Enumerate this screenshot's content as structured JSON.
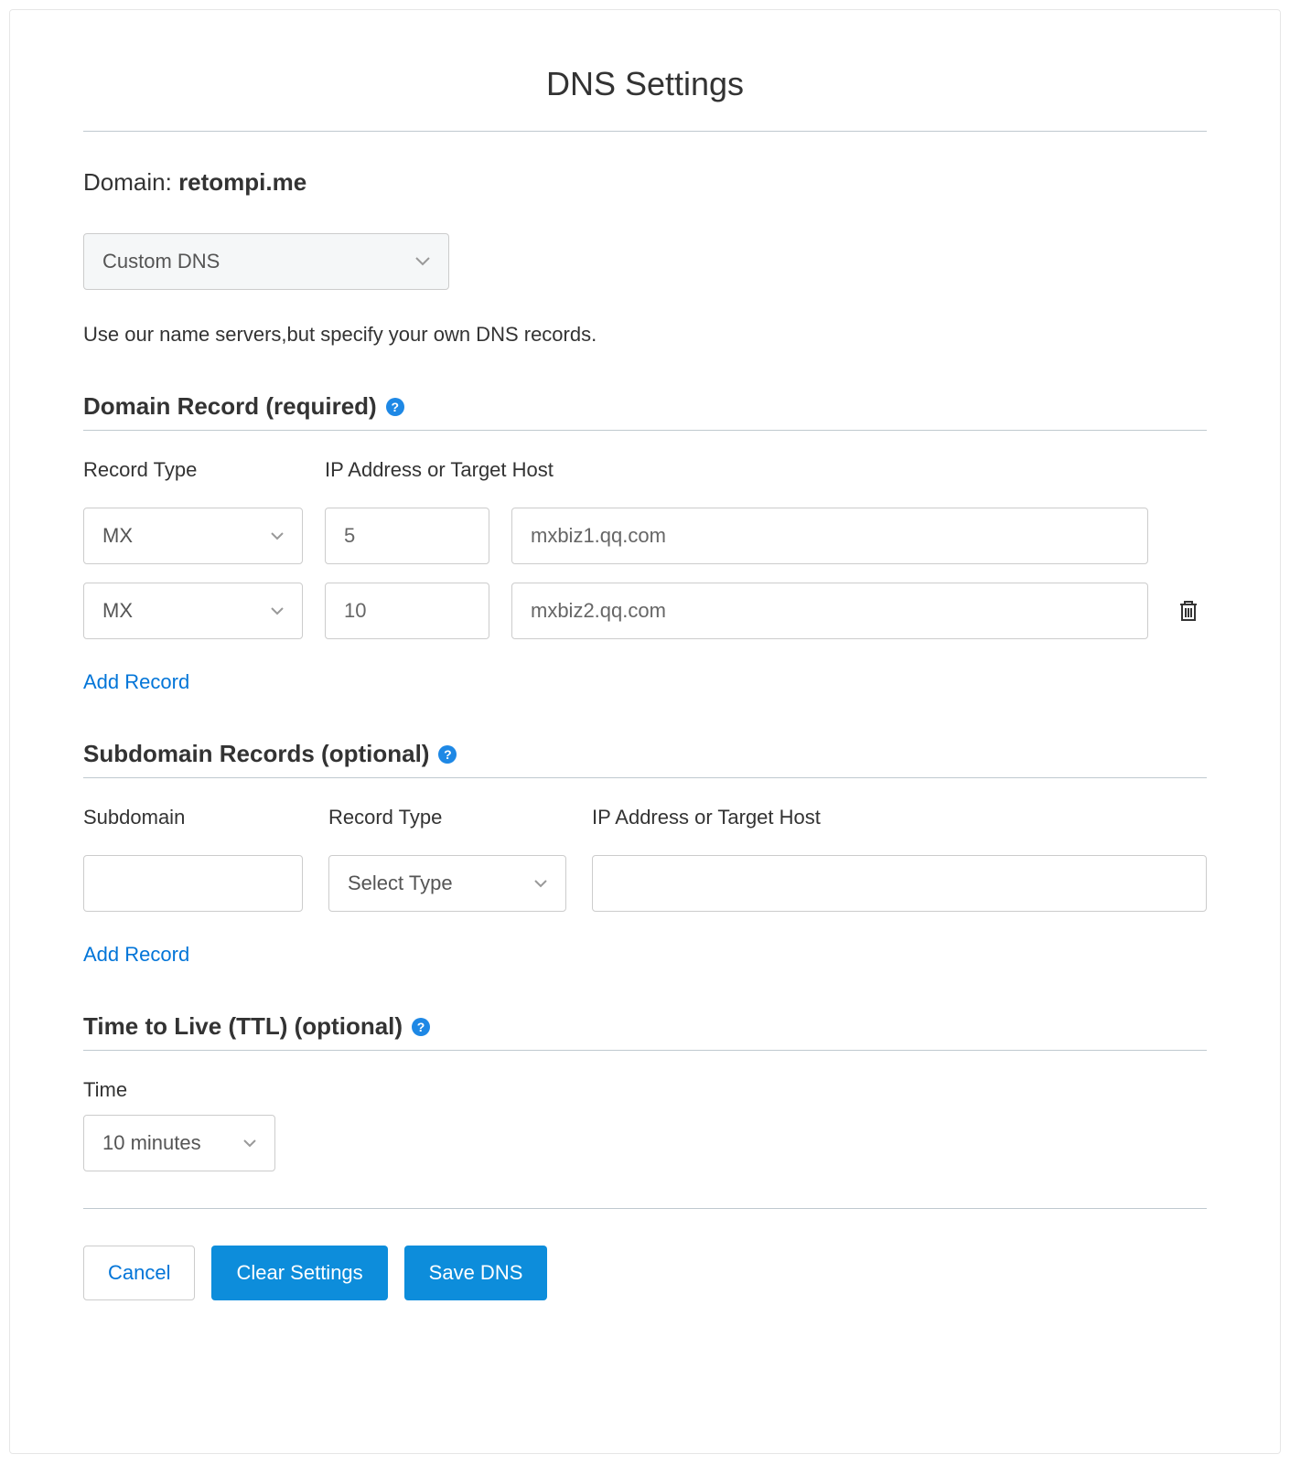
{
  "page": {
    "title": "DNS Settings"
  },
  "domain": {
    "label": "Domain:",
    "value": "retompi.me"
  },
  "dns_mode": {
    "selected": "Custom DNS",
    "help_text": "Use our name servers,but specify your own DNS records."
  },
  "domain_record": {
    "heading": "Domain Record (required)",
    "col": {
      "type": "Record Type",
      "target": "IP Address or Target Host"
    },
    "rows": [
      {
        "type": "MX",
        "priority": "5",
        "target": "mxbiz1.qq.com",
        "deletable": false
      },
      {
        "type": "MX",
        "priority": "10",
        "target": "mxbiz2.qq.com",
        "deletable": true
      }
    ],
    "add_label": "Add Record"
  },
  "subdomain": {
    "heading": "Subdomain Records (optional)",
    "col": {
      "sub": "Subdomain",
      "type": "Record Type",
      "target": "IP Address or Target Host"
    },
    "row": {
      "sub": "",
      "type_placeholder": "Select Type",
      "target": ""
    },
    "add_label": "Add Record"
  },
  "ttl": {
    "heading": "Time to Live (TTL) (optional)",
    "label": "Time",
    "value": "10 minutes"
  },
  "buttons": {
    "cancel": "Cancel",
    "clear": "Clear Settings",
    "save": "Save DNS"
  }
}
